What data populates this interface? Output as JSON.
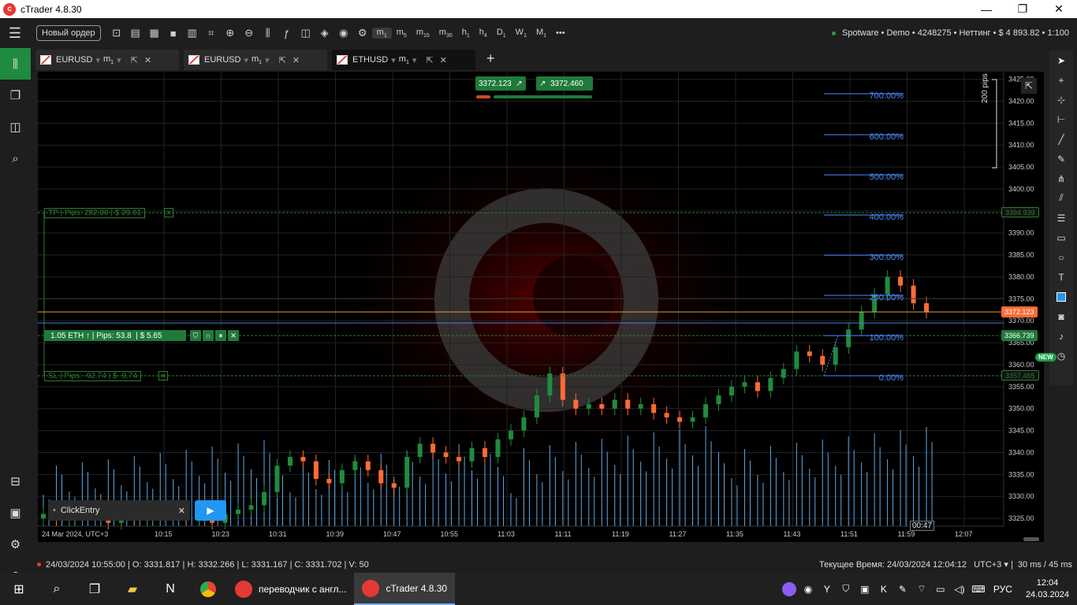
{
  "window": {
    "title": "cTrader 4.8.30",
    "minimize": "—",
    "restore": "❐",
    "close": "✕"
  },
  "toolbar": {
    "new_order_label": "Новый ордер",
    "timeframes": [
      {
        "main": "m",
        "sub": "1",
        "active": true
      },
      {
        "main": "m",
        "sub": "5"
      },
      {
        "main": "m",
        "sub": "15"
      },
      {
        "main": "m",
        "sub": "30"
      },
      {
        "main": "h",
        "sub": "1"
      },
      {
        "main": "h",
        "sub": "4"
      },
      {
        "main": "D",
        "sub": "1"
      },
      {
        "main": "W",
        "sub": "1"
      },
      {
        "main": "M",
        "sub": "1"
      }
    ],
    "more": "•••",
    "account": "Spotware • Demo • 4248275 • Неттинг • $ 4 893.82 • 1:100"
  },
  "tabs": [
    {
      "symbol": "EURUSD",
      "tf": "m",
      "tf_sub": "1",
      "active": false
    },
    {
      "symbol": "EURUSD",
      "tf": "m",
      "tf_sub": "1",
      "active": false
    },
    {
      "symbol": "ETHUSD",
      "tf": "m",
      "tf_sub": "1",
      "active": true
    }
  ],
  "quote": {
    "bid": "3372.123",
    "ask": "3372.460"
  },
  "positions": {
    "tp": {
      "label": "TP",
      "pips": "Pips: 282.00",
      "usd": "$ 29.61",
      "price": "3394.939"
    },
    "entry": {
      "label": "1.05 ETH",
      "pips": "Pips: 53.8",
      "usd": "$ 5.65",
      "price": "3366.739"
    },
    "sl": {
      "label": "SL",
      "pips": "Pips: -92.74",
      "usd": "$ -9.74",
      "price": "3357.465"
    },
    "current": "3372.123"
  },
  "fib_levels": [
    "700.00%",
    "600.00%",
    "500.00%",
    "400.00%",
    "300.00%",
    "200.00%",
    "100.00%",
    "0.00%"
  ],
  "pips_label": "200 pips",
  "price_axis": [
    "3425.00",
    "3420.00",
    "3415.00",
    "3410.00",
    "3405.00",
    "3400.00",
    "3395.00",
    "3390.00",
    "3385.00",
    "3380.00",
    "3375.00",
    "3370.00",
    "3365.00",
    "3360.00",
    "3355.00",
    "3350.00",
    "3345.00",
    "3340.00",
    "3335.00",
    "3330.00",
    "3325.00"
  ],
  "time_axis": [
    "24 Mar 2024, UTC+3",
    "10:15",
    "10:23",
    "10:31",
    "10:39",
    "10:47",
    "10:55",
    "11:03",
    "11:11",
    "11:19",
    "11:27",
    "11:35",
    "11:43",
    "11:51",
    "11:59",
    "12:07"
  ],
  "countdown": "00:47",
  "clickentry": {
    "label": "ClickEntry",
    "close": "✕"
  },
  "status": {
    "bar": "24/03/2024 10:55:00",
    "o": "O: 3331.817",
    "h": "H: 3332.266",
    "l": "L: 3331.167",
    "c": "C: 3331.702",
    "v": "V: 50",
    "server_time": "Текущее Время: 24/03/2024 12:04:12",
    "tz": "UTC+3",
    "latency": "30 ms / 45 ms"
  },
  "right_badge": "NEW",
  "taskbar": {
    "apps": [
      {
        "label": "переводчик с англ...",
        "color": "#e53935"
      },
      {
        "label": "cTrader 4.8.30",
        "color": "#e53935"
      }
    ],
    "lang": "РУС",
    "time": "12:04",
    "date": "24.03.2024"
  },
  "colors": {
    "bull": "#1f8b3f",
    "bear": "#ff6b35",
    "tp": "#2e7d32",
    "fib": "#4a8bff",
    "volume": "#5da9e8"
  },
  "chart_data": {
    "type": "candlestick",
    "title": "ETHUSD m1",
    "candles_approx_close": [
      3326,
      3325,
      3327,
      3326,
      3328,
      3324,
      3327,
      3325,
      3328,
      3326,
      3327,
      3325,
      3326,
      3324,
      3326,
      3327,
      3328,
      3331,
      3337,
      3339,
      3338,
      3334,
      3333,
      3336,
      3338,
      3336,
      3333,
      3332,
      3339,
      3342,
      3340,
      3339,
      3338,
      3341,
      3339,
      3343,
      3345,
      3348,
      3353,
      3358,
      3352,
      3350,
      3351,
      3350,
      3352,
      3350,
      3351,
      3349,
      3348,
      3347,
      3348,
      3351,
      3353,
      3355,
      3356,
      3354,
      3357,
      3359,
      3363,
      3362,
      3360,
      3364,
      3368,
      3372,
      3376,
      3380,
      3378,
      3374,
      3372
    ]
  }
}
